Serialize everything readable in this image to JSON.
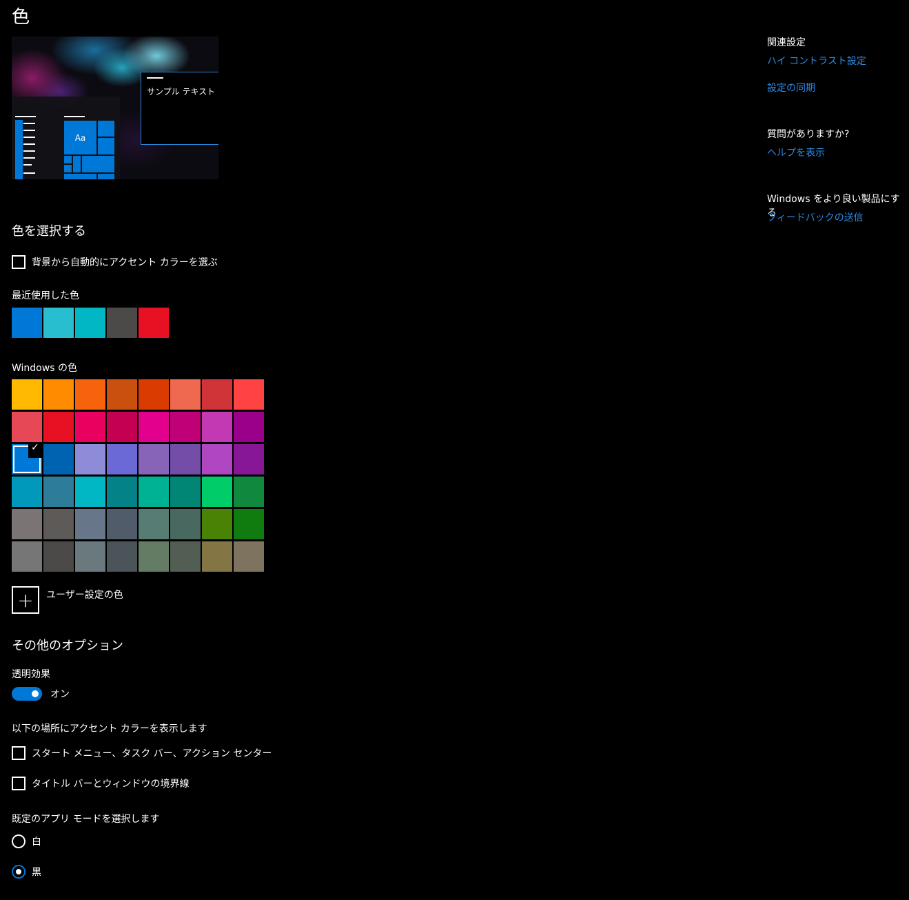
{
  "page": {
    "title": "色"
  },
  "preview": {
    "sample_text": "サンプル テキスト",
    "tile_text": "Aa"
  },
  "choose_color": {
    "heading": "色を選択する",
    "auto_accent_label": "背景から自動的にアクセント カラーを選ぶ",
    "recent_label": "最近使用した色",
    "recent_colors": [
      "#0078d7",
      "#29bdd0",
      "#00b7c3",
      "#4c4a48",
      "#e81123"
    ],
    "windows_colors_label": "Windows の色",
    "windows_colors": [
      [
        "#ffb900",
        "#ff8c00",
        "#f7630c",
        "#ca5010",
        "#da3b01",
        "#ef6950",
        "#d13438",
        "#ff4343"
      ],
      [
        "#e74856",
        "#e81123",
        "#ea005e",
        "#c30052",
        "#e3008c",
        "#bf0077",
        "#c239b3",
        "#9a0089"
      ],
      [
        "#0078d7",
        "#0063b1",
        "#8e8cd8",
        "#6b69d6",
        "#8764b8",
        "#744da9",
        "#b146c2",
        "#881798"
      ],
      [
        "#0099bc",
        "#2d7d9a",
        "#00b7c3",
        "#038387",
        "#00b294",
        "#018574",
        "#00cc6a",
        "#10893e"
      ],
      [
        "#7a7574",
        "#5d5a58",
        "#68768a",
        "#515c6b",
        "#567c73",
        "#486860",
        "#498205",
        "#107c10"
      ],
      [
        "#767676",
        "#4c4a48",
        "#69797e",
        "#4a5459",
        "#647c64",
        "#525e54",
        "#847545",
        "#7e735f"
      ]
    ],
    "selected_color": "#0078d7",
    "custom_color_label": "ユーザー設定の色"
  },
  "more_options": {
    "heading": "その他のオプション",
    "transparency_label": "透明効果",
    "transparency_state": "オン",
    "accent_surfaces_label": "以下の場所にアクセント カラーを表示します",
    "start_taskbar_label": "スタート メニュー、タスク バー、アクション センター",
    "titlebar_label": "タイトル バーとウィンドウの境界線",
    "app_mode_label": "既定のアプリ モードを選択します",
    "mode_light": "白",
    "mode_dark": "黒",
    "selected_mode": "黒"
  },
  "sidebar": {
    "related_heading": "関連設定",
    "high_contrast_link": "ハイ コントラスト設定",
    "sync_link": "設定の同期",
    "question_heading": "質問がありますか?",
    "help_link": "ヘルプを表示",
    "improve_heading": "Windows をより良い製品にする",
    "feedback_link": "フィードバックの送信"
  },
  "accent_color": "#0078d7",
  "link_color": "#2d8ae6",
  "icons": {
    "plus": "plus-icon",
    "check": "checkmark-icon"
  }
}
